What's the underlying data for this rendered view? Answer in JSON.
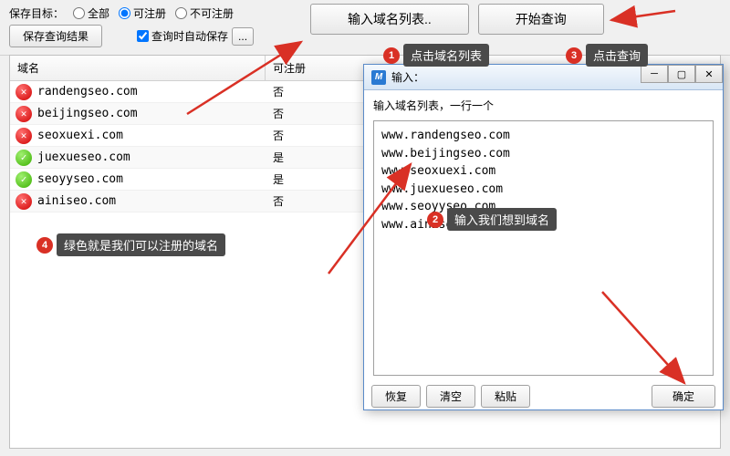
{
  "toolbar": {
    "save_target_label": "保存目标：",
    "radio_all": "全部",
    "radio_registerable": "可注册",
    "radio_not_registerable": "不可注册",
    "save_result_btn": "保存查询结果",
    "auto_save_cb": "查询时自动保存",
    "ellipsis_btn": "...",
    "input_list_btn": "输入域名列表..",
    "start_query_btn": "开始查询"
  },
  "table": {
    "col_domain": "域名",
    "col_registerable": "可注册",
    "rows": [
      {
        "domain": "randengseo.com",
        "status": "no",
        "status_text": "否"
      },
      {
        "domain": "beijingseo.com",
        "status": "no",
        "status_text": "否"
      },
      {
        "domain": "seoxuexi.com",
        "status": "no",
        "status_text": "否"
      },
      {
        "domain": "juexueseo.com",
        "status": "yes",
        "status_text": "是"
      },
      {
        "domain": "seoyyseo.com",
        "status": "yes",
        "status_text": "是"
      },
      {
        "domain": "ainiseo.com",
        "status": "no",
        "status_text": "否"
      }
    ]
  },
  "dialog": {
    "title": "输入：",
    "instruction": "输入域名列表，一行一个",
    "lines": [
      "www.randengseo.com",
      "www.beijingseo.com",
      "www.seoxuexi.com",
      "www.juexueseo.com",
      "www.seoyyseo.com",
      "www.ainiseo.com"
    ],
    "btn_restore": "恢复",
    "btn_clear": "清空",
    "btn_paste": "粘贴",
    "btn_ok": "确定"
  },
  "annotations": {
    "a1": "点击域名列表",
    "a2": "输入我们想到域名",
    "a3": "点击查询",
    "a4": "绿色就是我们可以注册的域名"
  }
}
